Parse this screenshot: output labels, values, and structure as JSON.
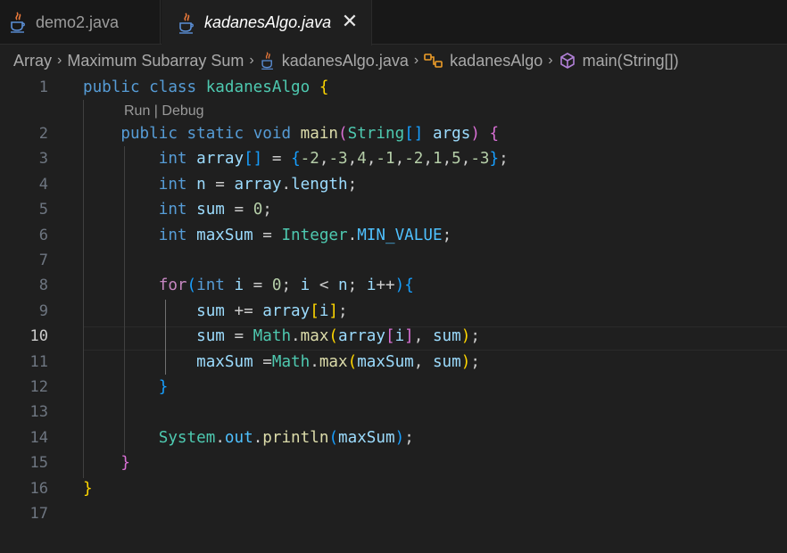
{
  "tabs": [
    {
      "label": "demo2.java",
      "icon": "java-icon",
      "active": false
    },
    {
      "label": "kadanesAlgo.java",
      "icon": "java-icon",
      "active": true,
      "close_glyph": "✕"
    }
  ],
  "breadcrumb": {
    "items": [
      "Array",
      "Maximum Subarray Sum",
      "kadanesAlgo.java",
      "kadanesAlgo",
      "main(String[])"
    ],
    "separator": "›"
  },
  "codelens": {
    "run": "Run",
    "sep": " | ",
    "debug": "Debug"
  },
  "editor": {
    "active_line": 10,
    "lines": [
      {
        "n": "1"
      },
      {
        "n": "2"
      },
      {
        "n": "3"
      },
      {
        "n": "4"
      },
      {
        "n": "5"
      },
      {
        "n": "6"
      },
      {
        "n": "7"
      },
      {
        "n": "8"
      },
      {
        "n": "9"
      },
      {
        "n": "10"
      },
      {
        "n": "11"
      },
      {
        "n": "12"
      },
      {
        "n": "13"
      },
      {
        "n": "14"
      },
      {
        "n": "15"
      },
      {
        "n": "16"
      },
      {
        "n": "17"
      }
    ],
    "tokens": {
      "public": "public",
      "class": "class",
      "classname": "kadanesAlgo",
      "static": "static",
      "void": "void",
      "main": "main",
      "String": "String",
      "args": "args",
      "int": "int",
      "array": "array",
      "n": "n",
      "sum": "sum",
      "maxSum": "maxSum",
      "Integer": "Integer",
      "MIN_VALUE": "MIN_VALUE",
      "length": "length",
      "for": "for",
      "i": "i",
      "Math": "Math",
      "max": "max",
      "System": "System",
      "out": "out",
      "println": "println",
      "values": [
        "-2",
        "-3",
        "4",
        "-1",
        "-2",
        "1",
        "5",
        "-3"
      ],
      "zero": "0"
    }
  },
  "colors": {
    "background": "#1f1f1f",
    "tabbar": "#181818",
    "keyword": "#569cd6",
    "control": "#c586c0",
    "type": "#4ec9b0",
    "function": "#dcdcaa",
    "variable": "#9cdcfe",
    "constant": "#4fc1ff",
    "number": "#b5cea8",
    "bracket1": "#ffd700",
    "bracket2": "#da70d6",
    "bracket3": "#179fff"
  }
}
